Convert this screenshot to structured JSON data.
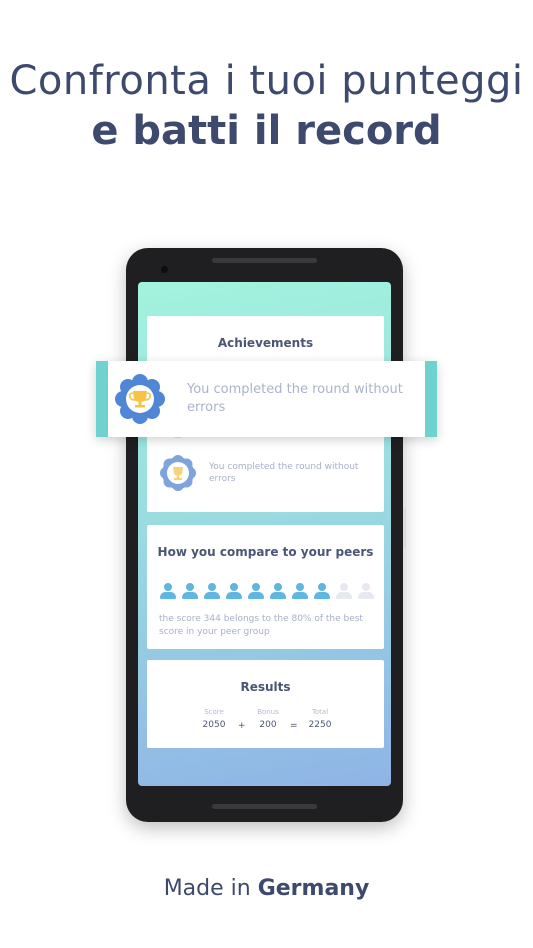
{
  "headline": {
    "line1": "Confronta i tuoi punteggi",
    "line2": "e batti il record"
  },
  "footer": {
    "prefix": "Made in ",
    "country": "Germany"
  },
  "achievements": {
    "title": "Achievements",
    "banner_text": "You completed the round without errors",
    "partial_item_text": "errors",
    "item_text": "You completed the round without errors",
    "badge_icon": "trophy-badge-icon"
  },
  "peers": {
    "title": "How you compare to your peers",
    "filled_count": 8,
    "total_count": 10,
    "description": "the score 344 belongs to the 80% of the best score in your peer group"
  },
  "results": {
    "title": "Results",
    "score_label": "Score",
    "score_value": "2050",
    "plus": "+",
    "bonus_label": "Bonus",
    "bonus_value": "200",
    "equals": "=",
    "total_label": "Total",
    "total_value": "2250"
  },
  "colors": {
    "text_dark": "#3d4a6e",
    "accent_teal": "#6fd2cf",
    "peer_active": "#5fb6df",
    "badge_blue": "#4f86d6",
    "trophy_gold": "#f6c344"
  }
}
